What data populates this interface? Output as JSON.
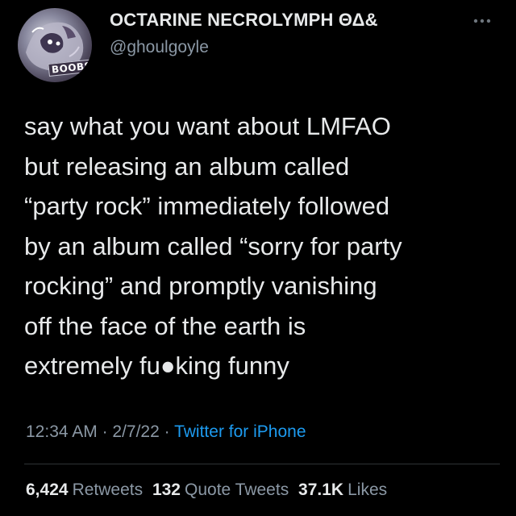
{
  "tweet": {
    "author": {
      "display_name": "OCTARINE NECROLYMPH ΘΔ&",
      "handle": "@ghoulgoyle",
      "avatar_text": "BOOBS"
    },
    "text": "say what you want about LMFAO\nbut releasing an album called\n“party rock” immediately followed\nby an album called “sorry for party\nrocking” and promptly vanishing\noff the face of the earth is\nextremely fu●king funny",
    "meta": {
      "time": "12:34 AM",
      "separator": " · ",
      "date": "2/7/22",
      "separator2": " · ",
      "source": "Twitter for iPhone"
    },
    "stats": {
      "retweets_count": "6,424",
      "retweets_label": "Retweets",
      "quotes_count": "132",
      "quotes_label": "Quote Tweets",
      "likes_count": "37.1K",
      "likes_label": "Likes"
    }
  },
  "colors": {
    "background": "#000000",
    "text_primary": "#e7e9ea",
    "text_secondary": "#8b98a5",
    "link": "#1d9bf0",
    "divider": "#2f3336"
  },
  "icons": {
    "more": "more-horizontal-icon"
  }
}
